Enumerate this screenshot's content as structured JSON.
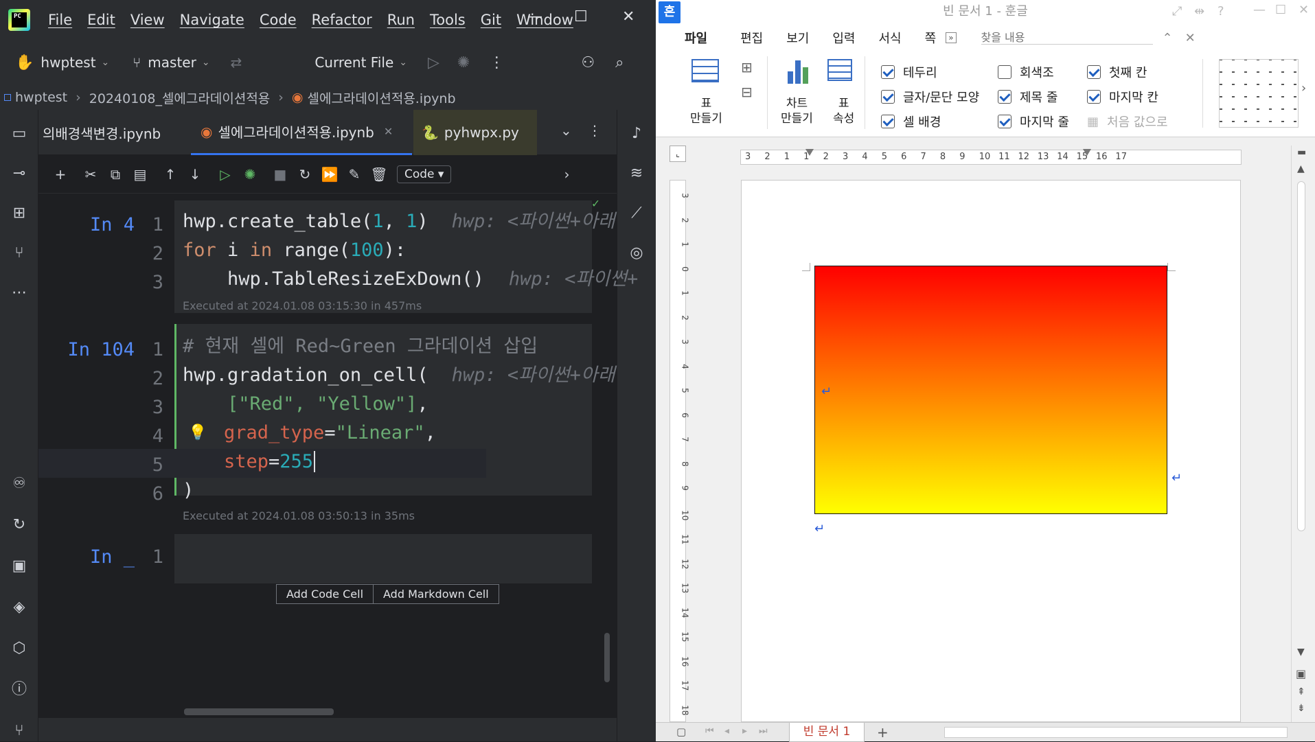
{
  "ide": {
    "menu": [
      "File",
      "Edit",
      "View",
      "Navigate",
      "Code",
      "Refactor",
      "Run",
      "Tools",
      "Git",
      "Window"
    ],
    "logo_text": "PC",
    "project": "hwptest",
    "branch": "master",
    "run_config": "Current File",
    "breadcrumbs": [
      "hwptest",
      "20240108_셀에그라데이션적용",
      "셀에그라데이션적용.ipynb"
    ],
    "tabs": [
      {
        "label": "의배경색변경.ipynb",
        "active": false
      },
      {
        "label": "셀에그라데이션적용.ipynb",
        "active": true
      },
      {
        "label": "pyhwpx.py",
        "active": false
      }
    ],
    "cell_type": "Code",
    "cells": [
      {
        "prompt": "In 4",
        "executed": "Executed at 2024.01.08 03:15:30 in 457ms"
      },
      {
        "prompt": "In 104",
        "executed": "Executed at 2024.01.08 03:50:13 in 35ms"
      },
      {
        "prompt": "In _"
      }
    ],
    "code": {
      "c1l1a": "hwp.create_table(",
      "c1l1b": "1",
      "c1l1c": ", ",
      "c1l1d": "1",
      "c1l1e": ")",
      "c1l1hint": "hwp: <파이썬+아래",
      "c1l2a": "for",
      "c1l2b": " i ",
      "c1l2c": "in",
      "c1l2d": " range(",
      "c1l2e": "100",
      "c1l2f": "):",
      "c1l3a": "    hwp.TableResizeExDown()",
      "c1l3hint": "hwp: <파이썬+",
      "c2l1": "# 현재 셀에 Red~Green 그라데이션 삽입",
      "c2l2a": "hwp.gradation_on_cell(",
      "c2l2hint": "hwp: <파이썬+아래",
      "c2l3a": "    ",
      "c2l3b": "[\"Red\", \"Yellow\"]",
      "c2l3c": ",",
      "c2l4a": "grad_type",
      "c2l4b": "=",
      "c2l4c": "\"Linear\"",
      "c2l4d": ",",
      "c2l5a": "step",
      "c2l5b": "=",
      "c2l5c": "255",
      "c2l6": ")"
    },
    "add_code_cell": "Add Code Cell",
    "add_markdown_cell": "Add Markdown Cell"
  },
  "hwp": {
    "app_icon": "흔",
    "title": "빈 문서 1 - 훈글",
    "menu": [
      "파일",
      "편집",
      "보기",
      "입력",
      "서식",
      "쪽"
    ],
    "search_placeholder": "찾을 내용",
    "ribbon": {
      "table_make": "표\n만들기",
      "chart_make": "차트\n만들기",
      "table_props": "표\n속성",
      "checks": [
        {
          "label": "테두리",
          "on": true
        },
        {
          "label": "글자/문단 모양",
          "on": true
        },
        {
          "label": "셀 배경",
          "on": true
        },
        {
          "label": "회색조",
          "on": false
        },
        {
          "label": "제목 줄",
          "on": true
        },
        {
          "label": "마지막 줄",
          "on": true
        },
        {
          "label": "첫째 칸",
          "on": true
        },
        {
          "label": "마지막 칸",
          "on": true
        },
        {
          "label": "처음 값으로",
          "on": false
        }
      ]
    },
    "ruler_numbers": [
      "3",
      "2",
      "1",
      "1",
      "2",
      "3",
      "4",
      "5",
      "6",
      "7",
      "8",
      "9",
      "10",
      "11",
      "12",
      "13",
      "14",
      "15",
      "16",
      "17"
    ],
    "vruler_numbers": [
      "3",
      "2",
      "1",
      "0",
      "1",
      "2",
      "3",
      "4",
      "5",
      "6",
      "7",
      "8",
      "9",
      "10",
      "11",
      "12",
      "13",
      "14",
      "15",
      "16",
      "17",
      "18"
    ],
    "gradient": {
      "top": "#ff0000",
      "bottom": "#ffff00"
    },
    "doc_tab": "빈 문서 1",
    "add_tab": "+"
  }
}
